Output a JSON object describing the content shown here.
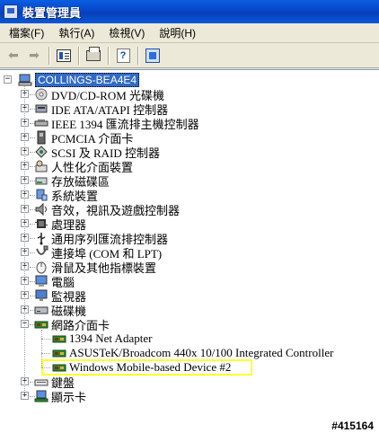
{
  "window": {
    "title": "裝置管理員"
  },
  "menu": [
    {
      "label": "檔案(F)"
    },
    {
      "label": "執行(A)"
    },
    {
      "label": "檢視(V)"
    },
    {
      "label": "說明(H)"
    }
  ],
  "tree": {
    "root": {
      "label": "COLLINGS-BEA4E4",
      "state": "expanded"
    },
    "categories": [
      {
        "label": "DVD/CD-ROM 光碟機",
        "icon": "cdrom-icon",
        "state": "collapsed"
      },
      {
        "label": "IDE ATA/ATAPI 控制器",
        "icon": "ide-controller-icon",
        "state": "collapsed"
      },
      {
        "label": "IEEE 1394 匯流排主機控制器",
        "icon": "ieee1394-icon",
        "state": "collapsed"
      },
      {
        "label": "PCMCIA 介面卡",
        "icon": "pcmcia-icon",
        "state": "collapsed"
      },
      {
        "label": "SCSI 及 RAID 控制器",
        "icon": "scsi-icon",
        "state": "collapsed"
      },
      {
        "label": "人性化介面裝置",
        "icon": "hid-icon",
        "state": "collapsed"
      },
      {
        "label": "存放磁碟區",
        "icon": "storage-volume-icon",
        "state": "collapsed"
      },
      {
        "label": "系統裝置",
        "icon": "system-device-icon",
        "state": "collapsed"
      },
      {
        "label": "音效，視訊及遊戲控制器",
        "icon": "sound-icon",
        "state": "collapsed"
      },
      {
        "label": "處理器",
        "icon": "processor-icon",
        "state": "collapsed"
      },
      {
        "label": "通用序列匯流排控制器",
        "icon": "usb-icon",
        "state": "collapsed"
      },
      {
        "label": "連接埠 (COM 和 LPT)",
        "icon": "port-icon",
        "state": "collapsed"
      },
      {
        "label": "滑鼠及其他指標裝置",
        "icon": "mouse-icon",
        "state": "collapsed"
      },
      {
        "label": "電腦",
        "icon": "computer-icon",
        "state": "collapsed"
      },
      {
        "label": "監視器",
        "icon": "monitor-icon",
        "state": "collapsed"
      },
      {
        "label": "磁碟機",
        "icon": "disk-drive-icon",
        "state": "collapsed"
      },
      {
        "label": "網路介面卡",
        "icon": "network-adapter-icon",
        "state": "expanded",
        "children": [
          {
            "label": "1394 Net Adapter",
            "icon": "network-card-icon"
          },
          {
            "label": "ASUSTeK/Broadcom 440x 10/100 Integrated Controller",
            "icon": "network-card-icon"
          },
          {
            "label": "Windows Mobile-based Device #2",
            "icon": "network-card-icon"
          }
        ]
      },
      {
        "label": "鍵盤",
        "icon": "keyboard-icon",
        "state": "collapsed"
      },
      {
        "label": "顯示卡",
        "icon": "display-adapter-icon",
        "state": "collapsed"
      }
    ]
  },
  "watermark": "#415164",
  "colors": {
    "title_bar": "#0845c9",
    "selection": "#316ac5",
    "highlight_box": "#ffff33"
  }
}
